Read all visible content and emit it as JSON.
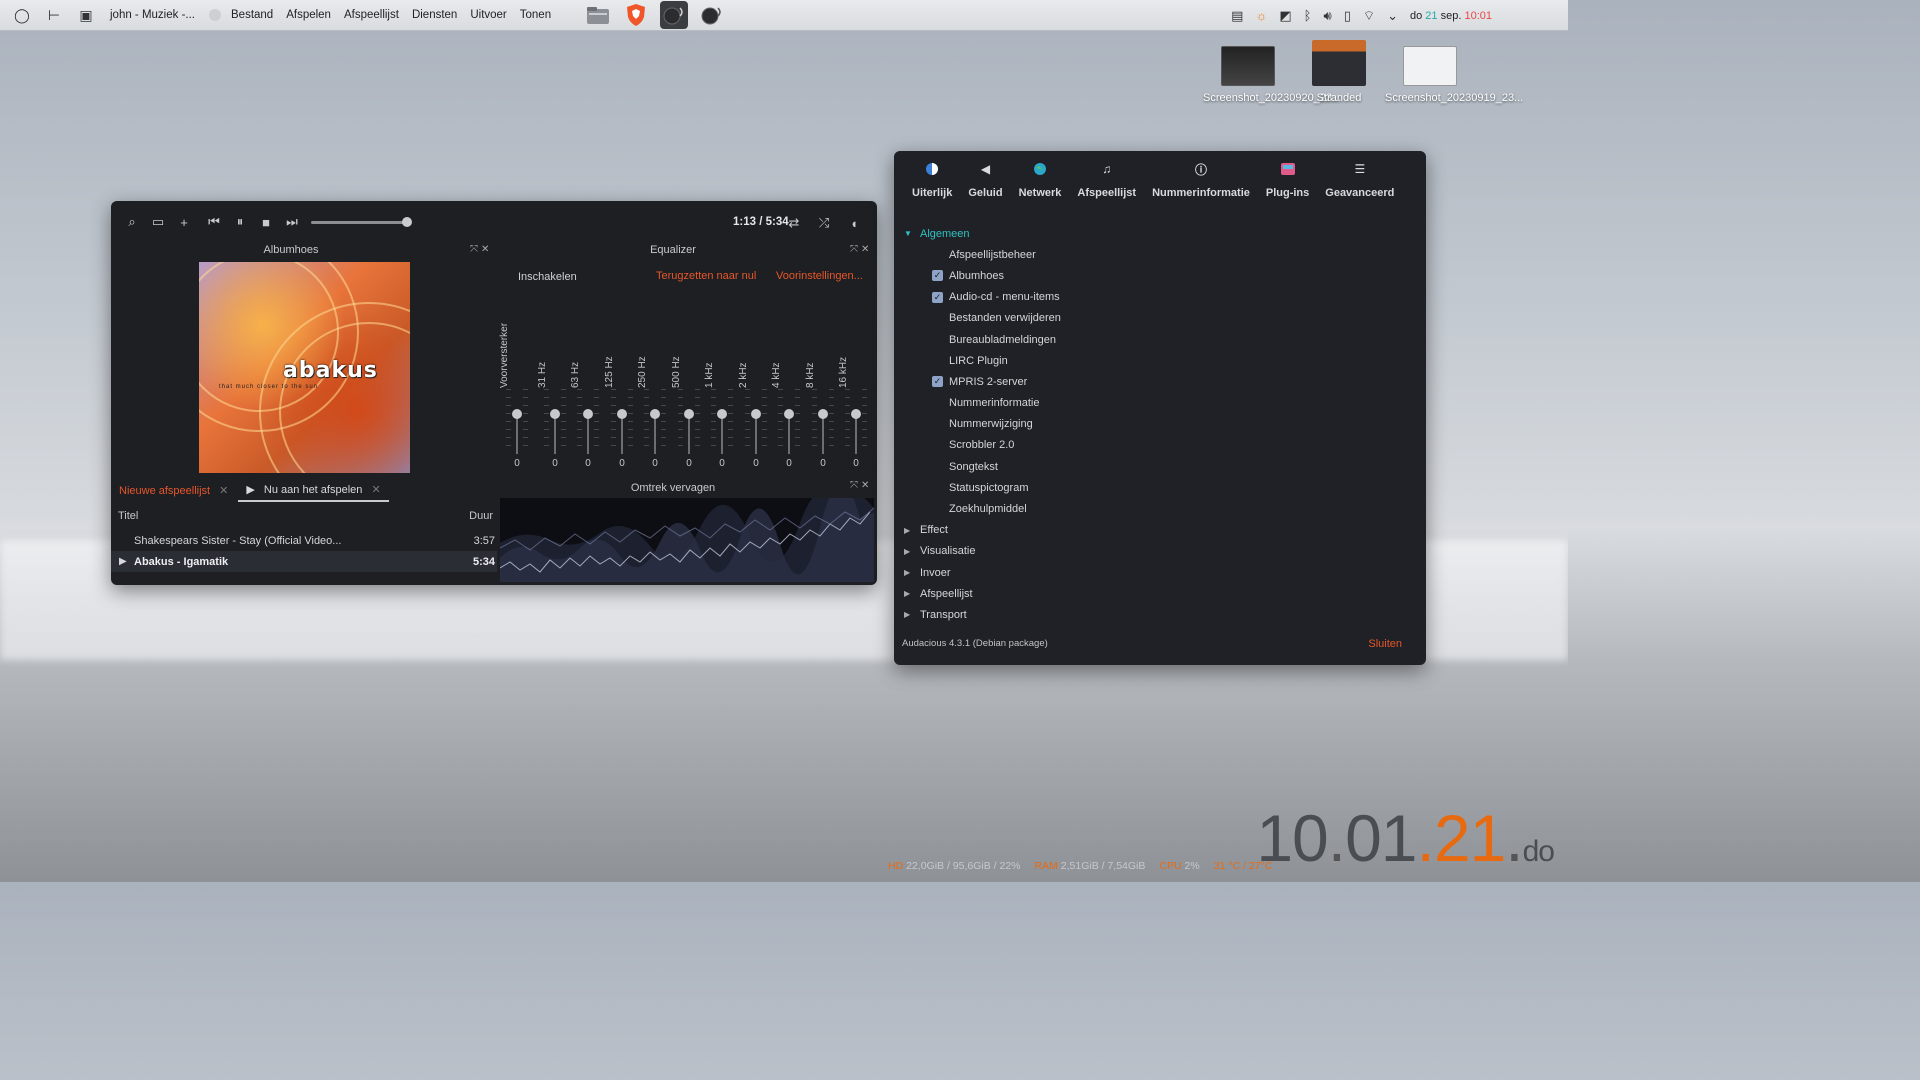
{
  "topbar": {
    "window_title": "john - Muziek -...",
    "menus": [
      "Bestand",
      "Afspelen",
      "Afspeellijst",
      "Diensten",
      "Uitvoer",
      "Tonen"
    ],
    "date_prefix": "do",
    "date_day": "21",
    "date_rest": "sep.",
    "time": "10:01"
  },
  "desktop": {
    "icons": [
      {
        "label": "Screenshot_20230920_23..."
      },
      {
        "label": "Stranded"
      },
      {
        "label": "Screenshot_20230919_23..."
      }
    ],
    "clock": {
      "hour": "10",
      "sep1": ".",
      "min": "01",
      "sep2": ".",
      "day": "21",
      "sep3": ".",
      "dow": "do"
    },
    "stats": {
      "hd_label": "HD",
      "hd_value": "22,0GiB / 95,6GiB / 22%",
      "ram_label": "RAM",
      "ram_value": "2,51GiB / 7,54GiB",
      "cpu_label": "CPU",
      "cpu_value": "2%",
      "temp_value": "31 °C / 27°C"
    }
  },
  "player": {
    "time": "1:13 / 5:34",
    "seek_fraction": 1.0,
    "albumart": {
      "title": "Albumhoes",
      "brand": "abakus",
      "subtitle": "that much closer to the sun"
    },
    "equalizer": {
      "title": "Equalizer",
      "enable_label": "Inschakelen",
      "reset_label": "Terugzetten naar nul",
      "presets_label": "Voorinstellingen...",
      "bands": [
        {
          "label": "Voorversterker",
          "value": "0"
        },
        {
          "label": "31 Hz",
          "value": "0"
        },
        {
          "label": "63 Hz",
          "value": "0"
        },
        {
          "label": "125 Hz",
          "value": "0"
        },
        {
          "label": "250 Hz",
          "value": "0"
        },
        {
          "label": "500 Hz",
          "value": "0"
        },
        {
          "label": "1 kHz",
          "value": "0"
        },
        {
          "label": "2 kHz",
          "value": "0"
        },
        {
          "label": "4 kHz",
          "value": "0"
        },
        {
          "label": "8 kHz",
          "value": "0"
        },
        {
          "label": "16 kHz",
          "value": "0"
        }
      ]
    },
    "visualizer": {
      "title": "Omtrek vervagen"
    },
    "tabs": [
      {
        "label": "Nieuwe afspeellijst"
      },
      {
        "label": "Nu aan het afspelen"
      }
    ],
    "playlist": {
      "col_title": "Titel",
      "col_duration": "Duur",
      "rows": [
        {
          "title": "Shakespears Sister - Stay (Official Video...",
          "duration": "3:57"
        },
        {
          "title": "Abakus - Igamatik",
          "duration": "5:34"
        }
      ]
    }
  },
  "prefs": {
    "tabs": [
      {
        "label": "Uiterlijk",
        "icon": "appearance-icon"
      },
      {
        "label": "Geluid",
        "icon": "speaker-icon"
      },
      {
        "label": "Netwerk",
        "icon": "globe-icon"
      },
      {
        "label": "Afspeellijst",
        "icon": "music-note-icon"
      },
      {
        "label": "Nummerinformatie",
        "icon": "info-icon"
      },
      {
        "label": "Plug-ins",
        "icon": "plugin-icon"
      },
      {
        "label": "Geavanceerd",
        "icon": "advanced-icon"
      }
    ],
    "tree": {
      "general": "Algemeen",
      "plugins": [
        {
          "label": "Afspeellijstbeheer",
          "checked": false
        },
        {
          "label": "Albumhoes",
          "checked": true
        },
        {
          "label": "Audio-cd - menu-items",
          "checked": true
        },
        {
          "label": "Bestanden verwijderen",
          "checked": false
        },
        {
          "label": "Bureaubladmeldingen",
          "checked": false
        },
        {
          "label": "LIRC Plugin",
          "checked": false
        },
        {
          "label": "MPRIS 2-server",
          "checked": true
        },
        {
          "label": "Nummerinformatie",
          "checked": false
        },
        {
          "label": "Nummerwijziging",
          "checked": false
        },
        {
          "label": "Scrobbler 2.0",
          "checked": false
        },
        {
          "label": "Songtekst",
          "checked": false
        },
        {
          "label": "Statuspictogram",
          "checked": false
        },
        {
          "label": "Zoekhulpmiddel",
          "checked": false
        }
      ],
      "categories": [
        "Effect",
        "Visualisatie",
        "Invoer",
        "Afspeellijst",
        "Transport"
      ]
    },
    "footer": "Audacious 4.3.1 (Debian package)",
    "close_label": "Sluiten"
  },
  "colors": {
    "accent": "#e8562a",
    "tree_open": "#2fc2c2",
    "checkbox": "#8ea3c8"
  }
}
